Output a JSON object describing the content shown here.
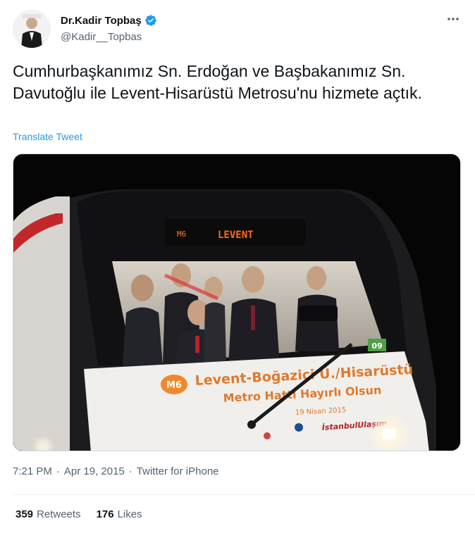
{
  "author": {
    "display_name": "Dr.Kadir Topbaş",
    "handle": "@Kadir__Topbas",
    "verified": true,
    "verified_color": "#1d9bf0"
  },
  "tweet": {
    "text": "Cumhurbaşkanımız Sn. Erdoğan ve Başbakanımız Sn. Davutoğlu ile Levent-Hisarüstü Metrosu'nu hizmete açtık.",
    "translate_label": "Translate Tweet"
  },
  "media": {
    "banner_line1": "Levent-Boğaziçi Ü./Hisarüstü",
    "banner_line2": "Metro Hattı Hayırlı Olsun",
    "banner_date": "19 Nisan 2015",
    "line_badge": "M6",
    "display_sign": "LEVENT",
    "display_code": "M6",
    "car_number": "09",
    "logo_text": "İstanbulUlaşım"
  },
  "meta": {
    "time": "7:21 PM",
    "separator": "·",
    "date": "Apr 19, 2015",
    "source": "Twitter for iPhone"
  },
  "stats": {
    "retweets_count": "359",
    "retweets_label": "Retweets",
    "likes_count": "176",
    "likes_label": "Likes"
  },
  "colors": {
    "link": "#1d9bf0",
    "secondary_text": "#536471",
    "primary_text": "#0f1419"
  }
}
